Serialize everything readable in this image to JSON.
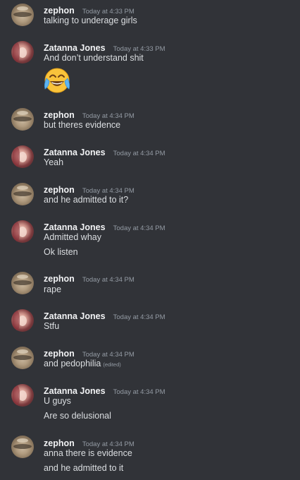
{
  "messages": [
    {
      "author": "zephon",
      "time": "Today at 4:33 PM",
      "lines": [
        "talking to underage girls"
      ]
    },
    {
      "author": "Zatanna Jones",
      "time": "Today at 4:33 PM",
      "lines": [
        "And don’t understand shit"
      ],
      "emoji": "joy-emoji"
    },
    {
      "author": "zephon",
      "time": "Today at 4:34 PM",
      "lines": [
        "but theres evidence"
      ]
    },
    {
      "author": "Zatanna Jones",
      "time": "Today at 4:34 PM",
      "lines": [
        "Yeah"
      ]
    },
    {
      "author": "zephon",
      "time": "Today at 4:34 PM",
      "lines": [
        "and he admitted to it?"
      ]
    },
    {
      "author": "Zatanna Jones",
      "time": "Today at 4:34 PM",
      "lines": [
        "Admitted whay",
        "Ok listen"
      ]
    },
    {
      "author": "zephon",
      "time": "Today at 4:34 PM",
      "lines": [
        "rape"
      ]
    },
    {
      "author": "Zatanna Jones",
      "time": "Today at 4:34 PM",
      "lines": [
        "Stfu"
      ]
    },
    {
      "author": "zephon",
      "time": "Today at 4:34 PM",
      "lines": [
        "and pedophilia"
      ],
      "edited_label": "(edited)"
    },
    {
      "author": "Zatanna Jones",
      "time": "Today at 4:34 PM",
      "lines": [
        "U guys",
        "Are so delusional"
      ]
    },
    {
      "author": "zephon",
      "time": "Today at 4:34 PM",
      "lines": [
        "anna there is evidence",
        "and he admitted to it"
      ]
    }
  ],
  "colors": {
    "background": "#313338",
    "username": "#f2f3f5",
    "timestamp": "#949ba4",
    "text": "#dbdee1"
  }
}
